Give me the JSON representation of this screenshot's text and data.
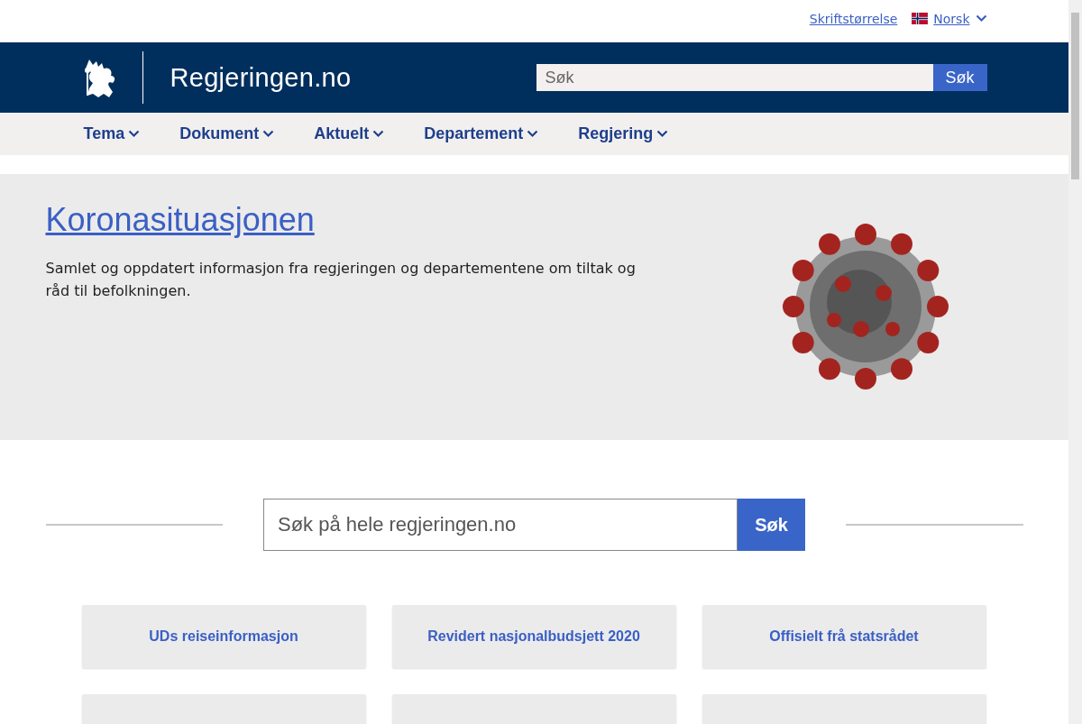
{
  "utility_bar": {
    "font_size_link": "Skriftstørrelse",
    "language": {
      "label": "Norsk"
    }
  },
  "header": {
    "site_name": "Regjeringen.no",
    "search": {
      "placeholder": "Søk",
      "button": "Søk"
    }
  },
  "nav": [
    {
      "label": "Tema"
    },
    {
      "label": "Dokument"
    },
    {
      "label": "Aktuelt"
    },
    {
      "label": "Departement"
    },
    {
      "label": "Regjering"
    }
  ],
  "hero": {
    "title": "Koronasituasjonen",
    "text": "Samlet og oppdatert informasjon fra regjeringen og departementene om tiltak og råd til befolkningen."
  },
  "site_search": {
    "placeholder": "Søk på hele regjeringen.no",
    "button": "Søk"
  },
  "quick_links": [
    {
      "kind": "link",
      "label": "UDs reiseinformasjon"
    },
    {
      "kind": "link",
      "label": "Revidert nasjonalbudsjett 2020"
    },
    {
      "kind": "link",
      "label": "Offisielt frå statsrådet"
    },
    {
      "kind": "cut_off"
    },
    {
      "kind": "cut_off"
    },
    {
      "kind": "cut_off"
    }
  ]
}
